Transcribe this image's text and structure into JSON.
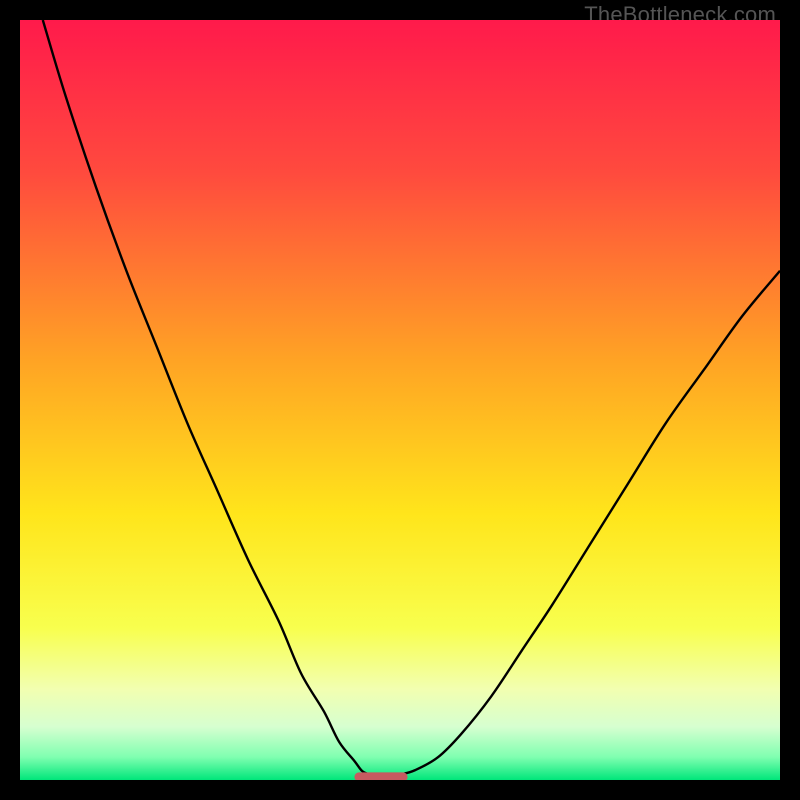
{
  "watermark": "TheBottleneck.com",
  "chart_data": {
    "type": "line",
    "title": "",
    "xlabel": "",
    "ylabel": "",
    "xlim": [
      0,
      100
    ],
    "ylim": [
      0,
      100
    ],
    "grid": false,
    "background_gradient": {
      "stops": [
        {
          "offset": 0.0,
          "color": "#ff1a4b"
        },
        {
          "offset": 0.2,
          "color": "#ff4a3e"
        },
        {
          "offset": 0.45,
          "color": "#ffa424"
        },
        {
          "offset": 0.65,
          "color": "#ffe51b"
        },
        {
          "offset": 0.8,
          "color": "#f8ff4e"
        },
        {
          "offset": 0.88,
          "color": "#f2ffb0"
        },
        {
          "offset": 0.93,
          "color": "#d6ffd0"
        },
        {
          "offset": 0.97,
          "color": "#7fffb0"
        },
        {
          "offset": 1.0,
          "color": "#00e67a"
        }
      ]
    },
    "series": [
      {
        "name": "left-curve",
        "color": "#000000",
        "width": 2.4,
        "x": [
          3,
          6,
          10,
          14,
          18,
          22,
          26,
          30,
          34,
          37,
          40,
          42,
          44,
          45,
          46
        ],
        "values": [
          100,
          90,
          78,
          67,
          57,
          47,
          38,
          29,
          21,
          14,
          9,
          5,
          2.5,
          1.2,
          0.7
        ]
      },
      {
        "name": "right-curve",
        "color": "#000000",
        "width": 2.4,
        "x": [
          50,
          52,
          55,
          58,
          62,
          66,
          70,
          75,
          80,
          85,
          90,
          95,
          100
        ],
        "values": [
          0.7,
          1.3,
          3,
          6,
          11,
          17,
          23,
          31,
          39,
          47,
          54,
          61,
          67
        ]
      }
    ],
    "marker": {
      "name": "optimal-range",
      "type": "bar",
      "x_range": [
        44,
        51
      ],
      "y": 0.4,
      "height": 1.2,
      "color": "#c75a60",
      "radius": 0.6
    }
  }
}
